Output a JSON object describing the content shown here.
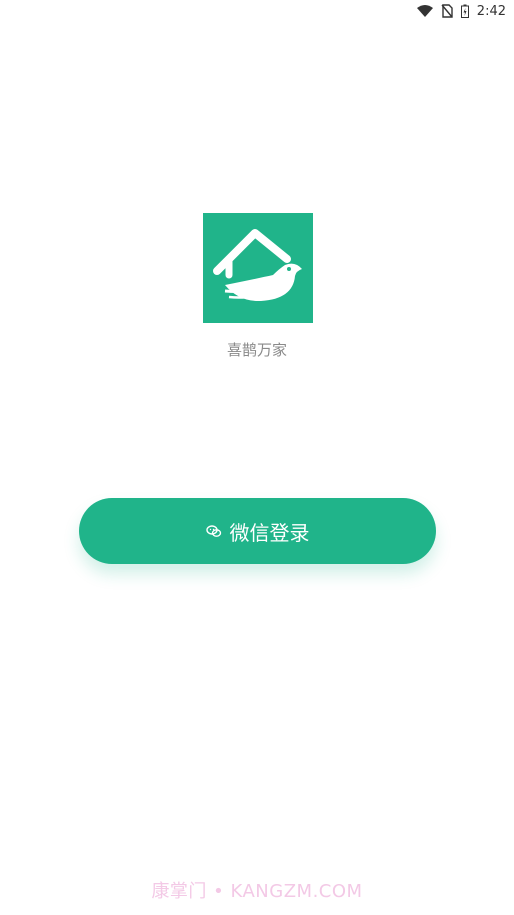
{
  "status_bar": {
    "time": "2:42",
    "icons": [
      "wifi-icon",
      "no-sim-icon",
      "battery-charging-icon"
    ]
  },
  "logo": {
    "icon": "house-magpie-logo-icon"
  },
  "app": {
    "name": "喜鹊万家"
  },
  "login": {
    "label": "微信登录",
    "icon": "wechat-icon"
  },
  "watermark": {
    "text": "康掌门 • KANGZM.COM"
  },
  "colors": {
    "brand": "#20b48a",
    "background": "#ffffff",
    "text_muted": "#8a8a8a",
    "watermark": "#f3c9e6"
  }
}
